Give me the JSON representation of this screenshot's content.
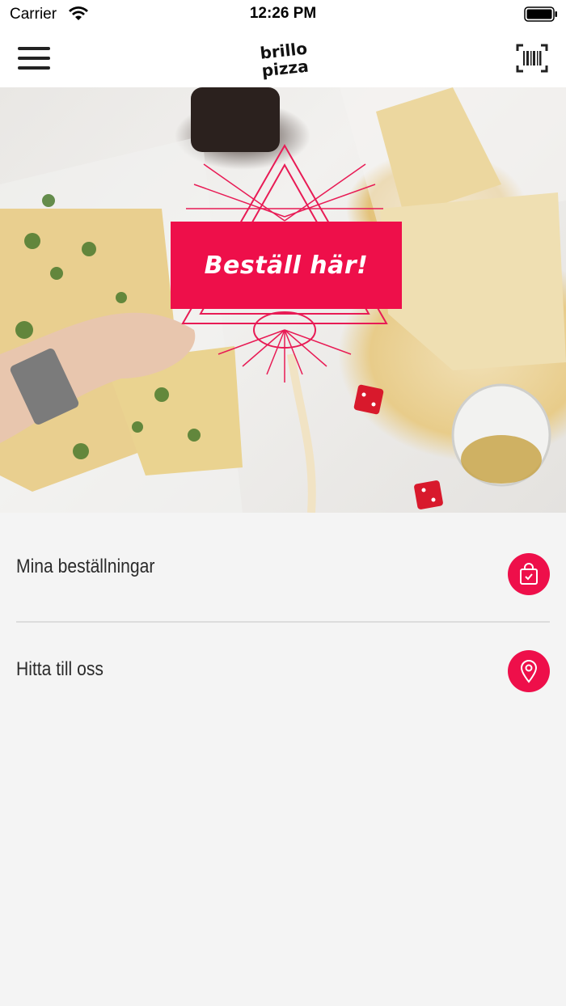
{
  "status_bar": {
    "carrier": "Carrier",
    "time": "12:26 PM"
  },
  "nav_bar": {
    "menu_icon": "hamburger-menu-icon",
    "logo_line1": "brillo",
    "logo_line2": "pizza",
    "scan_icon": "barcode-scan-icon"
  },
  "hero": {
    "order_label": "Beställ här!"
  },
  "menu": [
    {
      "label": "Mina beställningar",
      "icon": "shopping-bag-icon"
    },
    {
      "label": "Hitta till oss",
      "icon": "location-pin-icon"
    }
  ],
  "colors": {
    "accent": "#ee0f4a"
  }
}
